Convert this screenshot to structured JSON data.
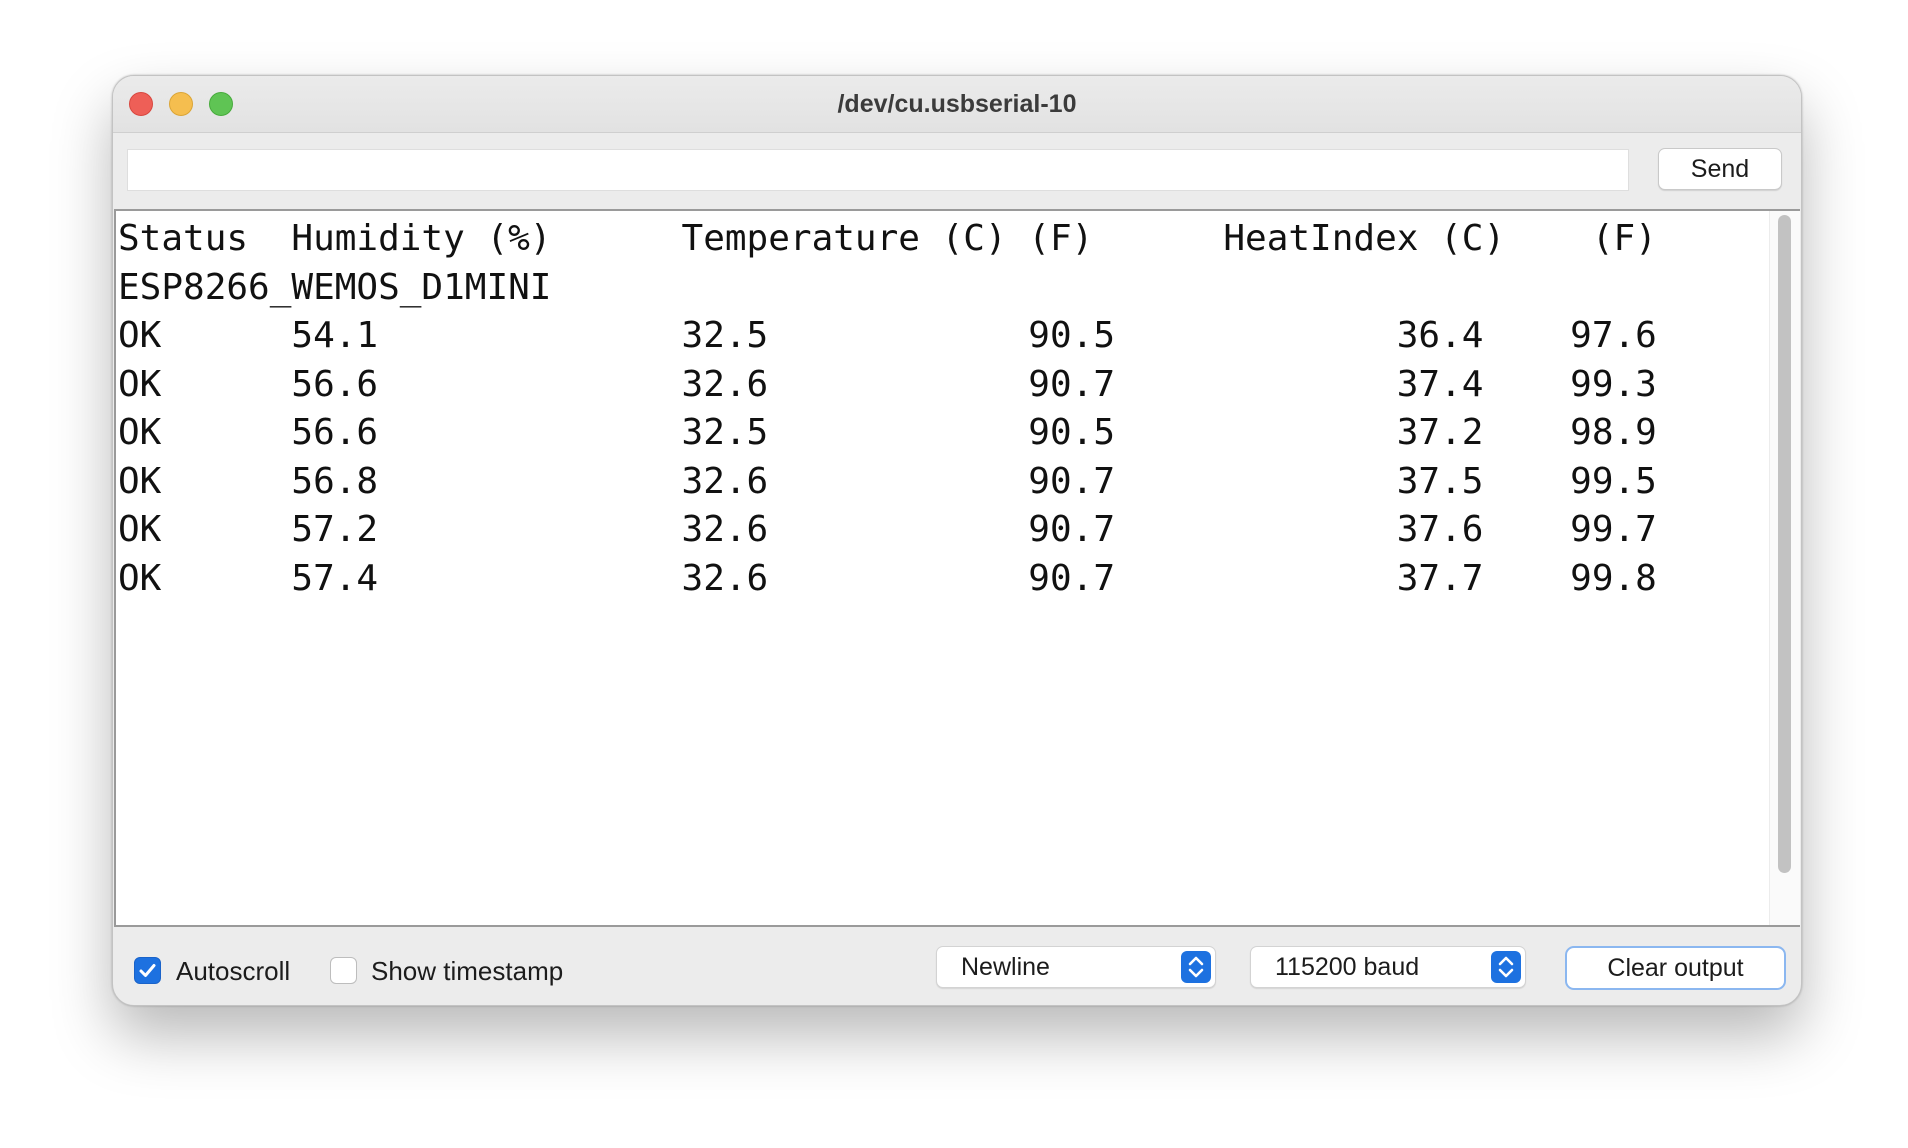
{
  "window": {
    "title": "/dev/cu.usbserial-10"
  },
  "send_input": {
    "value": "",
    "placeholder": ""
  },
  "send_button": {
    "label": "Send"
  },
  "serial_output": {
    "lines": [
      "Status  Humidity (%)      Temperature (C) (F)      HeatIndex (C)    (F)",
      "ESP8266_WEMOS_D1MINI",
      "OK      54.1              32.5            90.5             36.4    97.6",
      "OK      56.6              32.6            90.7             37.4    99.3",
      "OK      56.6              32.5            90.5             37.2    98.9",
      "OK      56.8              32.6            90.7             37.5    99.5",
      "OK      57.2              32.6            90.7             37.6    99.7",
      "OK      57.4              32.6            90.7             37.7    99.8"
    ]
  },
  "footer": {
    "autoscroll": {
      "label": "Autoscroll",
      "checked": true
    },
    "show_timestamp": {
      "label": "Show timestamp",
      "checked": false
    },
    "line_ending": {
      "selected": "Newline"
    },
    "baud_rate": {
      "selected": "115200 baud"
    },
    "clear_button": {
      "label": "Clear output"
    }
  },
  "colors": {
    "accent": "#1d71e0",
    "traffic_close": "#ee5f57",
    "traffic_minimize": "#f5be4f",
    "traffic_zoom": "#5fc454"
  },
  "icons": {
    "close": "close-icon",
    "minimize": "minimize-icon",
    "zoom": "zoom-icon",
    "checkmark": "checkmark-icon",
    "updown": "updown-chevron-icon"
  }
}
